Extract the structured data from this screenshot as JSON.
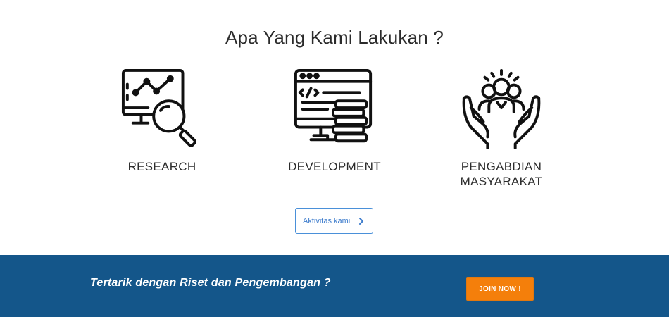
{
  "section": {
    "title": "Apa Yang Kami Lakukan ?"
  },
  "services": [
    {
      "label": "RESEARCH",
      "icon": "research-analytics-icon"
    },
    {
      "label": "DEVELOPMENT",
      "icon": "development-computer-icon"
    },
    {
      "label": "PENGABDIAN MASYARAKAT",
      "icon": "community-hands-icon"
    }
  ],
  "activity_button": {
    "label": "Aktivitas kami",
    "icon": "chevron-right-icon"
  },
  "cta": {
    "message": "Tertarik dengan Riset dan Pengembangan ?",
    "button_label": "JOIN NOW !"
  },
  "colors": {
    "cta_background": "#14568a",
    "join_button": "#f47f0b",
    "outline_button": "#4a90d9"
  }
}
